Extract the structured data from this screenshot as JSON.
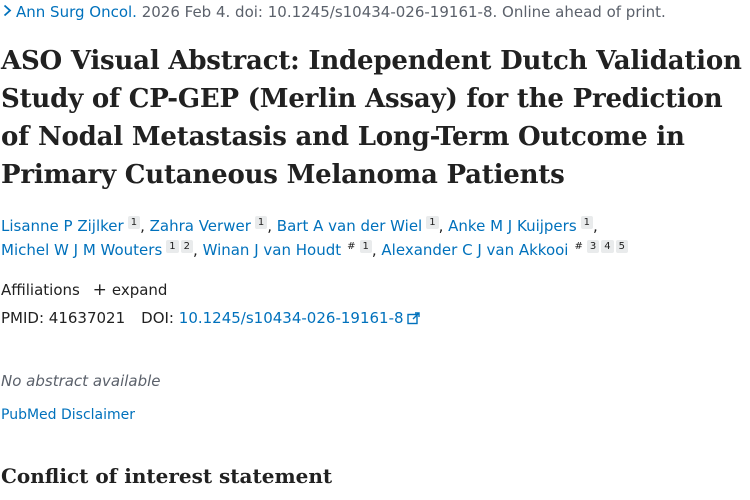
{
  "citation": {
    "journal": "Ann Surg Oncol.",
    "details": " 2026 Feb 4. doi: 10.1245/s10434-026-19161-8. Online ahead of print."
  },
  "title": "ASO Visual Abstract: Independent Dutch Validation Study of CP-GEP (Merlin Assay) for the Prediction of Nodal Metastasis and Long-Term Outcome in Primary Cutaneous Melanoma Patients",
  "authors": [
    {
      "name": "Lisanne P Zijlker",
      "marks": [
        "1"
      ]
    },
    {
      "name": "Zahra Verwer",
      "marks": [
        "1"
      ]
    },
    {
      "name": "Bart A van der Wiel",
      "marks": [
        "1"
      ]
    },
    {
      "name": "Anke M J Kuijpers",
      "marks": [
        "1"
      ]
    },
    {
      "name": "Michel W J M Wouters",
      "marks": [
        "1",
        "2"
      ]
    },
    {
      "name": "Winan J van Houdt",
      "marks": [
        "#",
        "1"
      ]
    },
    {
      "name": "Alexander C J van Akkooi",
      "marks": [
        "#",
        "3",
        "4",
        "5"
      ]
    }
  ],
  "affiliations": {
    "label": "Affiliations",
    "toggle_label": "expand"
  },
  "ids": {
    "pmid_label": "PMID:",
    "pmid": "41637021",
    "doi_label": "DOI:",
    "doi": "10.1245/s10434-026-19161-8"
  },
  "no_abstract": "No abstract available",
  "disclaimer": "PubMed Disclaimer",
  "section_heading": "Conflict of interest statement"
}
